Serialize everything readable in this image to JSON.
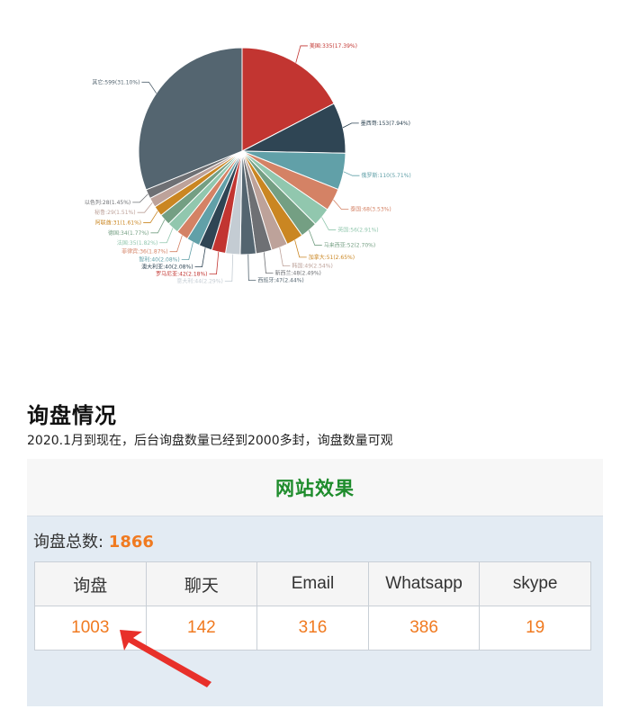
{
  "chart_data": {
    "type": "pie",
    "slices": [
      {
        "label": "美国:335(17.39%)",
        "value": 335,
        "color": "#c23531"
      },
      {
        "label": "墨西哥:153(7.94%)",
        "value": 153,
        "color": "#2f4554"
      },
      {
        "label": "俄罗斯:110(5.71%)",
        "value": 110,
        "color": "#61a0a8"
      },
      {
        "label": "泰国:68(3.53%)",
        "value": 68,
        "color": "#d48265"
      },
      {
        "label": "英国:56(2.91%)",
        "value": 56,
        "color": "#91c7ae"
      },
      {
        "label": "马来西亚:52(2.70%)",
        "value": 52,
        "color": "#749f83"
      },
      {
        "label": "加拿大:51(2.65%)",
        "value": 51,
        "color": "#ca8622"
      },
      {
        "label": "韩国:49(2.54%)",
        "value": 49,
        "color": "#bda29a"
      },
      {
        "label": "新西兰:48(2.49%)",
        "value": 48,
        "color": "#6e7074"
      },
      {
        "label": "西班牙:47(2.44%)",
        "value": 47,
        "color": "#546570"
      },
      {
        "label": "意大利:44(2.29%)",
        "value": 44,
        "color": "#c4ccd3"
      },
      {
        "label": "罗马尼亚:42(2.18%)",
        "value": 42,
        "color": "#c23531"
      },
      {
        "label": "澳大利亚:40(2.08%)",
        "value": 40,
        "color": "#2f4554"
      },
      {
        "label": "智利:40(2.08%)",
        "value": 40,
        "color": "#61a0a8"
      },
      {
        "label": "菲律宾:36(1.87%)",
        "value": 36,
        "color": "#d48265"
      },
      {
        "label": "法国:35(1.82%)",
        "value": 35,
        "color": "#91c7ae"
      },
      {
        "label": "德国:34(1.77%)",
        "value": 34,
        "color": "#749f83"
      },
      {
        "label": "阿联酋:31(1.61%)",
        "value": 31,
        "color": "#ca8622"
      },
      {
        "label": "秘鲁:29(1.51%)",
        "value": 29,
        "color": "#bda29a"
      },
      {
        "label": "以色列:28(1.45%)",
        "value": 28,
        "color": "#6e7074"
      },
      {
        "label": "其它:599(31.10%)",
        "value": 599,
        "color": "#546570"
      }
    ]
  },
  "section": {
    "heading": "询盘情况",
    "subtitle": "2020.1月到现在，后台询盘数量已经到2000多封，询盘数量可观"
  },
  "panel": {
    "title": "网站效果",
    "total_label": "询盘总数: ",
    "total_value": "1866",
    "columns": [
      "询盘",
      "聊天",
      "Email",
      "Whatsapp",
      "skype"
    ],
    "values": [
      "1003",
      "142",
      "316",
      "386",
      "19"
    ]
  },
  "colors": {
    "accent_orange": "#f07a20",
    "title_green": "#1e8c2c",
    "arrow_red": "#e8302a",
    "panel_bg": "#e3ebf3"
  }
}
